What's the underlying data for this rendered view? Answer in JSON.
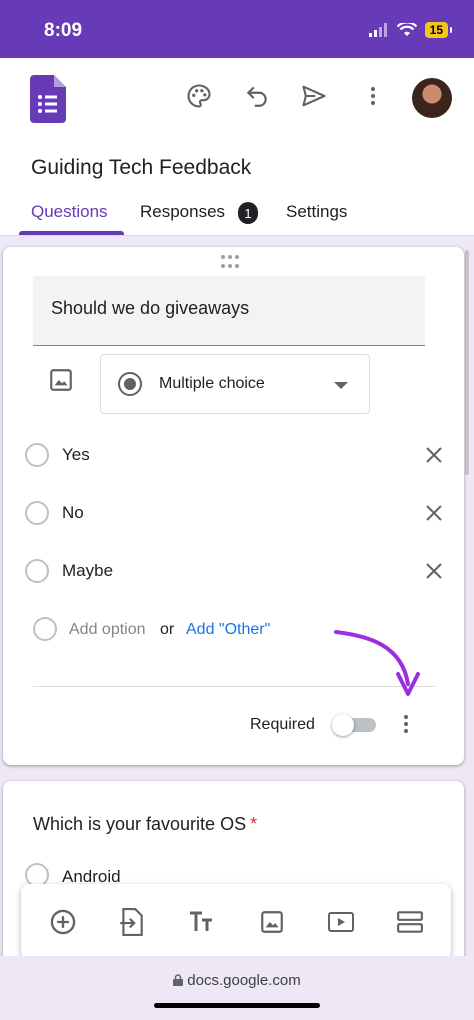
{
  "status": {
    "time": "8:09",
    "battery": "15"
  },
  "header": {
    "title": "Guiding Tech Feedback",
    "icons": [
      "forms-logo",
      "palette-icon",
      "undo-icon",
      "send-icon",
      "more-vert-icon",
      "avatar"
    ]
  },
  "tabs": [
    {
      "label": "Questions",
      "active": true
    },
    {
      "label": "Responses",
      "badge": "1"
    },
    {
      "label": "Settings"
    }
  ],
  "question1": {
    "title": "Should we do giveaways",
    "type": "Multiple choice",
    "options": [
      "Yes",
      "No",
      "Maybe"
    ],
    "add_option": "Add option",
    "or": "or",
    "add_other": "Add \"Other\"",
    "required_label": "Required",
    "required": false
  },
  "question2": {
    "title": "Which is your favourite OS",
    "required_mark": "*",
    "options": [
      "Android"
    ]
  },
  "bottom_toolbar": [
    "add-question-icon",
    "import-questions-icon",
    "add-title-icon",
    "add-image-icon",
    "add-video-icon",
    "add-section-icon"
  ],
  "browser": {
    "url": "docs.google.com"
  },
  "colors": {
    "accent": "#673ab7",
    "link": "#1a73e8",
    "annotation_arrow": "#9b2fe0",
    "required_star": "#d93025"
  }
}
